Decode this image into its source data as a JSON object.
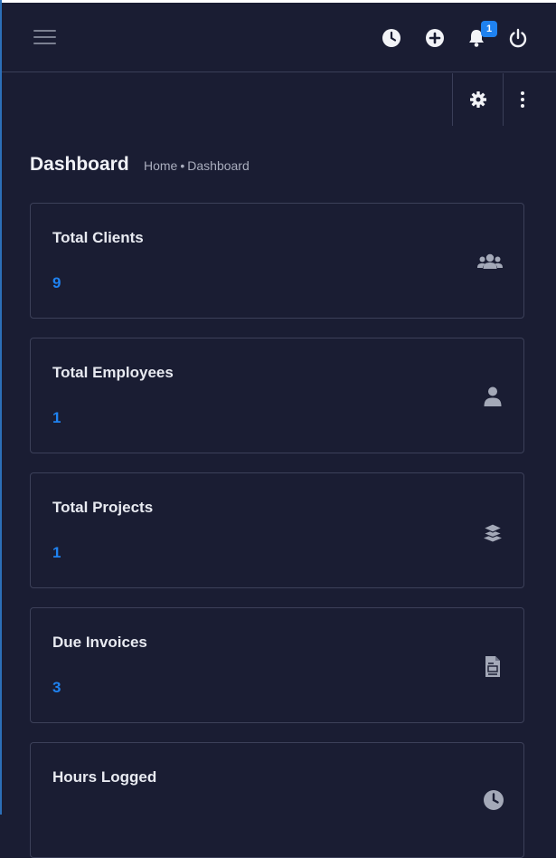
{
  "topbar": {
    "menu_icon": "hamburger-menu-icon",
    "icons": [
      "clock-icon",
      "plus-circle-icon",
      "bell-icon",
      "power-icon"
    ],
    "notification_count": "1"
  },
  "subbar": {
    "icons": [
      "gear-icon",
      "vertical-dots-icon"
    ]
  },
  "page": {
    "title": "Dashboard",
    "breadcrumb": {
      "home": "Home",
      "separator": "•",
      "current": "Dashboard"
    }
  },
  "cards": [
    {
      "title": "Total Clients",
      "value": "9",
      "icon": "users-icon"
    },
    {
      "title": "Total Employees",
      "value": "1",
      "icon": "user-icon"
    },
    {
      "title": "Total Projects",
      "value": "1",
      "icon": "layers-icon"
    },
    {
      "title": "Due Invoices",
      "value": "3",
      "icon": "invoice-icon"
    },
    {
      "title": "Hours Logged",
      "value": "",
      "icon": "clock-icon"
    }
  ],
  "colors": {
    "background": "#1a1d33",
    "accent": "#1f82f0",
    "icon": "#a4a9b8"
  }
}
